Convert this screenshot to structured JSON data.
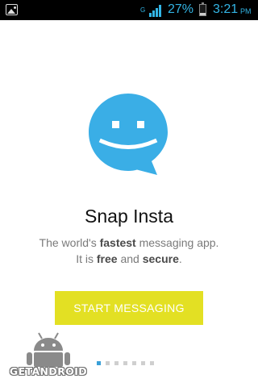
{
  "status_bar": {
    "network_type": "G",
    "battery_percent": "27%",
    "battery_level": 0.27,
    "time": "3:21",
    "ampm": "PM",
    "icons": [
      "gallery-icon",
      "signal-icon",
      "battery-icon"
    ]
  },
  "app": {
    "logo_icon": "smiling-chat-bubble-icon",
    "name": "Snap Insta",
    "tagline_parts": [
      "The world's ",
      "fastest",
      " messaging app.",
      "It is ",
      "free",
      " and ",
      "secure",
      "."
    ]
  },
  "start_button": {
    "label": "START MESSAGING",
    "color": "#e3e023"
  },
  "pager": {
    "total": 7,
    "active_index": 0,
    "active_color": "#3aa0d8"
  },
  "watermark": {
    "text": "GETANDROID",
    "icon": "android-robot-icon"
  },
  "colors": {
    "accent_blue": "#33b5e5",
    "logo_blue": "#3aaee6"
  }
}
